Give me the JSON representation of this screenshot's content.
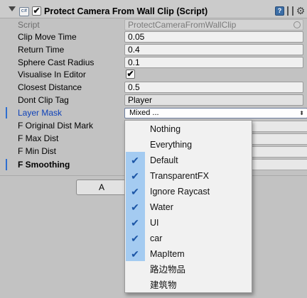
{
  "component": {
    "title": "Protect Camera From Wall Clip (Script)",
    "script_icon": "cs-script-icon",
    "enabled_glyph": "✔",
    "help_icon": "help-book-icon",
    "gear_glyph": "⚙"
  },
  "properties": {
    "script": {
      "label": "Script",
      "value": "ProtectCameraFromWallClip"
    },
    "clip_move_time": {
      "label": "Clip Move Time",
      "value": "0.05"
    },
    "return_time": {
      "label": "Return Time",
      "value": "0.4"
    },
    "sphere_cast_radius": {
      "label": "Sphere Cast Radius",
      "value": "0.1"
    },
    "visualise_in_editor": {
      "label": "Visualise In Editor",
      "checked": true,
      "glyph": "✔"
    },
    "closest_distance": {
      "label": "Closest Distance",
      "value": "0.5"
    },
    "dont_clip_tag": {
      "label": "Dont Clip Tag",
      "value": "Player"
    },
    "layer_mask": {
      "label": "Layer Mask",
      "value": "Mixed ...",
      "arrow": "⬍"
    },
    "f_original_dist_mark": {
      "label": "F Original Dist Mark"
    },
    "f_max_dist": {
      "label": "F Max Dist"
    },
    "f_min_dist": {
      "label": "F Min Dist"
    },
    "f_smoothing": {
      "label": "F Smoothing"
    }
  },
  "bottom_button": {
    "label": "A"
  },
  "layer_menu": {
    "check_glyph": "✔",
    "items": [
      {
        "label": "Nothing",
        "checked": false
      },
      {
        "label": "Everything",
        "checked": false
      },
      {
        "label": "Default",
        "checked": true
      },
      {
        "label": "TransparentFX",
        "checked": true
      },
      {
        "label": "Ignore Raycast",
        "checked": true
      },
      {
        "label": "Water",
        "checked": true
      },
      {
        "label": "UI",
        "checked": true
      },
      {
        "label": "car",
        "checked": true
      },
      {
        "label": "MapItem",
        "checked": true
      },
      {
        "label": "路边物品",
        "checked": false
      },
      {
        "label": "建筑物",
        "checked": false
      }
    ]
  },
  "colors": {
    "background": "#c2c2c2",
    "label_highlight": "#0f42b8",
    "menu_check_column": "#a4cbf1",
    "check_mark": "#1b55a6"
  }
}
